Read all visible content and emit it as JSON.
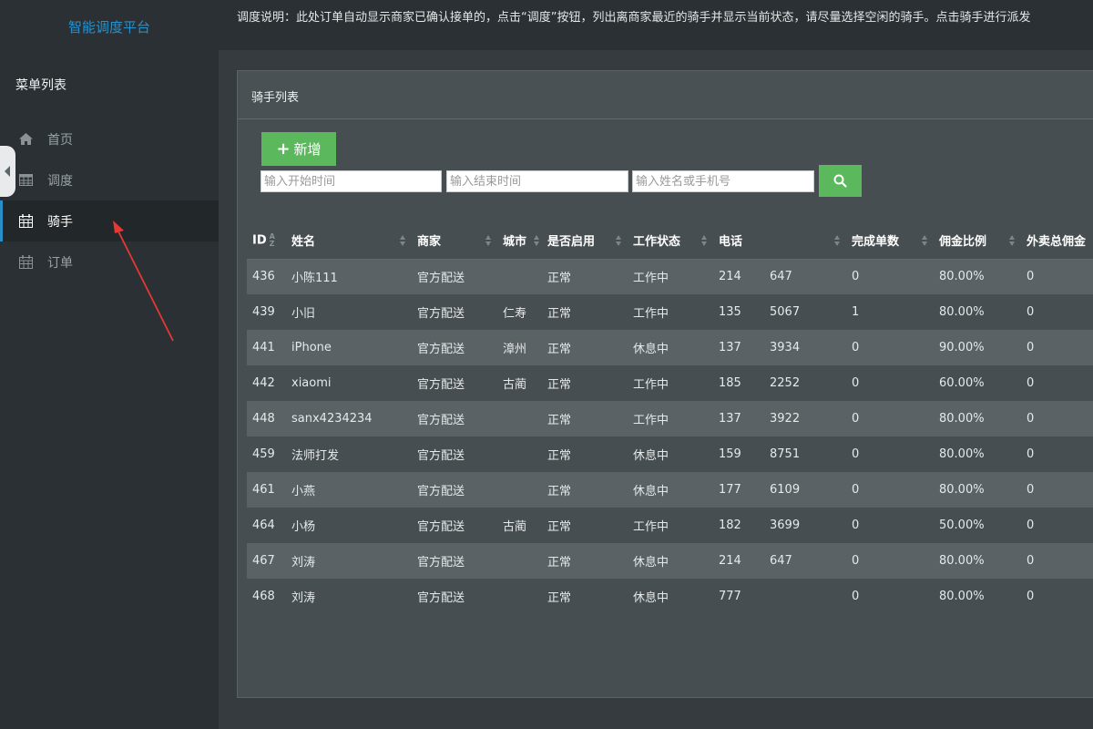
{
  "sidebar": {
    "brand": "智能调度平台",
    "menu_heading": "菜单列表",
    "items": [
      {
        "label": "首页",
        "icon": "home-icon"
      },
      {
        "label": "调度",
        "icon": "table-icon"
      },
      {
        "label": "骑手",
        "icon": "calendar-icon",
        "active": true
      },
      {
        "label": "订单",
        "icon": "calendar-icon"
      }
    ]
  },
  "notice": {
    "text": "调度说明：此处订单自动显示商家已确认接单的，点击“调度”按钮，列出离商家最近的骑手并显示当前状态，请尽量选择空闲的骑手。点击骑手进行派发"
  },
  "panel": {
    "title": "骑手列表",
    "add_label": "新增",
    "search": {
      "start_placeholder": "输入开始时间",
      "end_placeholder": "输入结束时间",
      "keyword_placeholder": "输入姓名或手机号"
    }
  },
  "table": {
    "columns": [
      "ID",
      "姓名",
      "商家",
      "城市",
      "是否启用",
      "工作状态",
      "电话",
      "",
      "完成单数",
      "佣金比例",
      "外卖总佣金"
    ],
    "rows": [
      [
        "436",
        "小陈111",
        "官方配送",
        "",
        "正常",
        "工作中",
        "214",
        "647",
        "0",
        "80.00%",
        "0"
      ],
      [
        "439",
        "小旧",
        "官方配送",
        "仁寿",
        "正常",
        "工作中",
        "135",
        "5067",
        "1",
        "80.00%",
        "0"
      ],
      [
        "441",
        "iPhone",
        "官方配送",
        "漳州",
        "正常",
        "休息中",
        "137",
        "3934",
        "0",
        "90.00%",
        "0"
      ],
      [
        "442",
        "xiaomi",
        "官方配送",
        "古蔺",
        "正常",
        "工作中",
        "185",
        "2252",
        "0",
        "60.00%",
        "0"
      ],
      [
        "448",
        "sanx4234234",
        "官方配送",
        "",
        "正常",
        "工作中",
        "137",
        "3922",
        "0",
        "80.00%",
        "0"
      ],
      [
        "459",
        "法师打发",
        "官方配送",
        "",
        "正常",
        "休息中",
        "159",
        "8751",
        "0",
        "80.00%",
        "0"
      ],
      [
        "461",
        "小燕",
        "官方配送",
        "",
        "正常",
        "休息中",
        "177",
        "6109",
        "0",
        "80.00%",
        "0"
      ],
      [
        "464",
        "小杨",
        "官方配送",
        "古蔺",
        "正常",
        "工作中",
        "182",
        "3699",
        "0",
        "50.00%",
        "0"
      ],
      [
        "467",
        "刘涛",
        "官方配送",
        "",
        "正常",
        "休息中",
        "214",
        "647",
        "0",
        "80.00%",
        "0"
      ],
      [
        "468",
        "刘涛",
        "官方配送",
        "",
        "正常",
        "休息中",
        "777",
        "",
        "0",
        "80.00%",
        "0"
      ]
    ]
  },
  "colors": {
    "accent": "#2a8fc9",
    "success": "#5cb85c",
    "annotation": "#e53935"
  }
}
